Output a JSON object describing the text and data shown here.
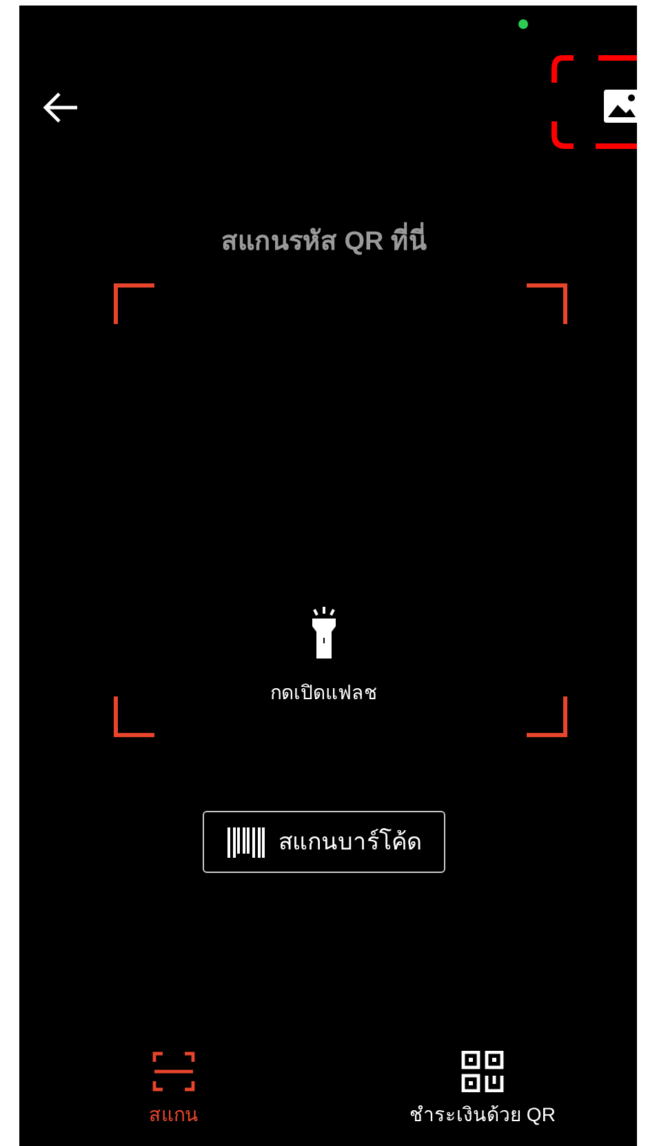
{
  "header": {
    "title": "สแกนรหัส QR ที่นี่"
  },
  "flash": {
    "label": "กดเปิดแฟลช",
    "on": false
  },
  "barcode_button": {
    "label": "สแกนบาร์โค้ด"
  },
  "tabs": [
    {
      "label": "สแกน",
      "selected": true,
      "kind": "scan"
    },
    {
      "label": "ชำระเงินด้วย QR",
      "selected": false,
      "kind": "qr"
    }
  ]
}
